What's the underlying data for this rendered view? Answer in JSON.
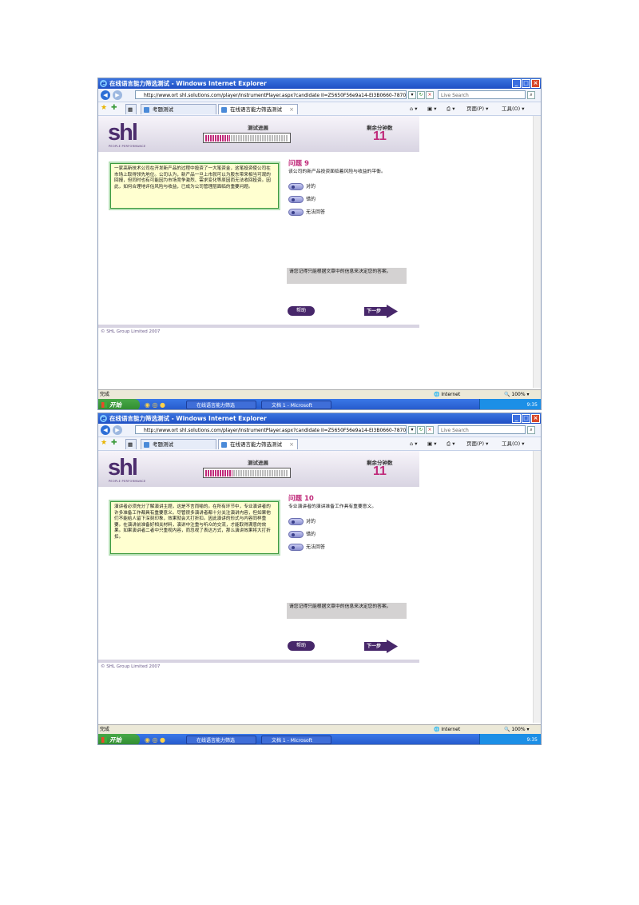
{
  "screens": [
    {
      "window": {
        "title": "在线语言能力筛选测试 - Windows Internet Explorer",
        "url": "http://www.ort shl.solutions.com/player/InstrumentPlayer.aspx?candidate II=Z5650F56e9a14-EI3B0660-7870",
        "search_placeholder": "Live Search",
        "favorites_tab": "考题测试",
        "active_tab": "在线语言能力筛选测试",
        "page_menu": "页面(P)",
        "tools_menu": "工具(O)"
      },
      "app": {
        "logo": "shl",
        "logo_sub": "PEOPLE PERFORMANCE",
        "progress_label": "测试进展",
        "progress_fraction": 0.3,
        "time_label": "剩余分钟数",
        "time_value": "11"
      },
      "passage": "一家高新技术公司在开发新产品的过程中投资了一大笔资金，这笔投资使公司在市场上取得领先地位。公司认为，新产品一旦上市就可以为股东带来相当可观的回报，但同时也有可能因为市场竞争激烈、需求变化等原因而无法收回投资。因此，如何合理地评估风险与收益，已成为公司管理层面临的重要问题。",
      "question": {
        "title": "问题 9",
        "statement": "该公司的新产品投资面临着风险与收益的平衡。",
        "options": [
          "对的",
          "错的",
          "无法回答"
        ]
      },
      "note": "请您记得只能根据文章中的信息来决定您的答案。",
      "help_label": "帮助",
      "next_label": "下一步",
      "copyright": "© SHL Group Limited 2007",
      "status": {
        "done": "完成",
        "zone": "Internet",
        "zoom": "100%"
      },
      "taskbar": {
        "start": "开始",
        "task1": "在线语言能力筛选",
        "task2": "文档 1 - Microsoft",
        "time": "9:35"
      }
    },
    {
      "window": {
        "title": "在线语言能力筛选测试 - Windows Internet Explorer",
        "url": "http://www.ort shl.solutions.com/player/InstrumentPlayer.aspx?candidate II=Z5650F56e9a14-EI3B0660-7870",
        "search_placeholder": "Live Search",
        "favorites_tab": "考题测试",
        "active_tab": "在线语言能力筛选测试",
        "page_menu": "页面(P)",
        "tools_menu": "工具(O)"
      },
      "app": {
        "logo": "shl",
        "logo_sub": "PEOPLE PERFORMANCE",
        "progress_label": "测试进展",
        "progress_fraction": 0.33,
        "time_label": "剩余分钟数",
        "time_value": "11"
      },
      "passage": "演讲者必须充分了解演讲主题，这是不言而喻的。在所有环节中，专业演讲者的许多准备工作都具有重要意义。尽管很多演讲者都十分关注演讲内容，但如果他们不能给人留下深刻印象，效果就会大打折扣。因此演讲的形式与内容同样重要。在演讲前准备好相关材料，演讲中注重与听众的交流，才能取得满意的效果。如果演讲者二者中只重视内容，而忽视了表达方式，那么演讲效果将大打折扣。",
      "question": {
        "title": "问题 10",
        "statement": "专业演讲者的演讲准备工作具有重要意义。",
        "options": [
          "对的",
          "错的",
          "无法回答"
        ]
      },
      "note": "请您记得只能根据文章中的信息来决定您的答案。",
      "help_label": "帮助",
      "next_label": "下一步",
      "copyright": "© SHL Group Limited 2007",
      "status": {
        "done": "完成",
        "zone": "Internet",
        "zoom": "100%"
      },
      "taskbar": {
        "start": "开始",
        "task1": "在线语言能力筛选",
        "task2": "文档 1 - Microsoft",
        "time": "9:35"
      }
    }
  ]
}
